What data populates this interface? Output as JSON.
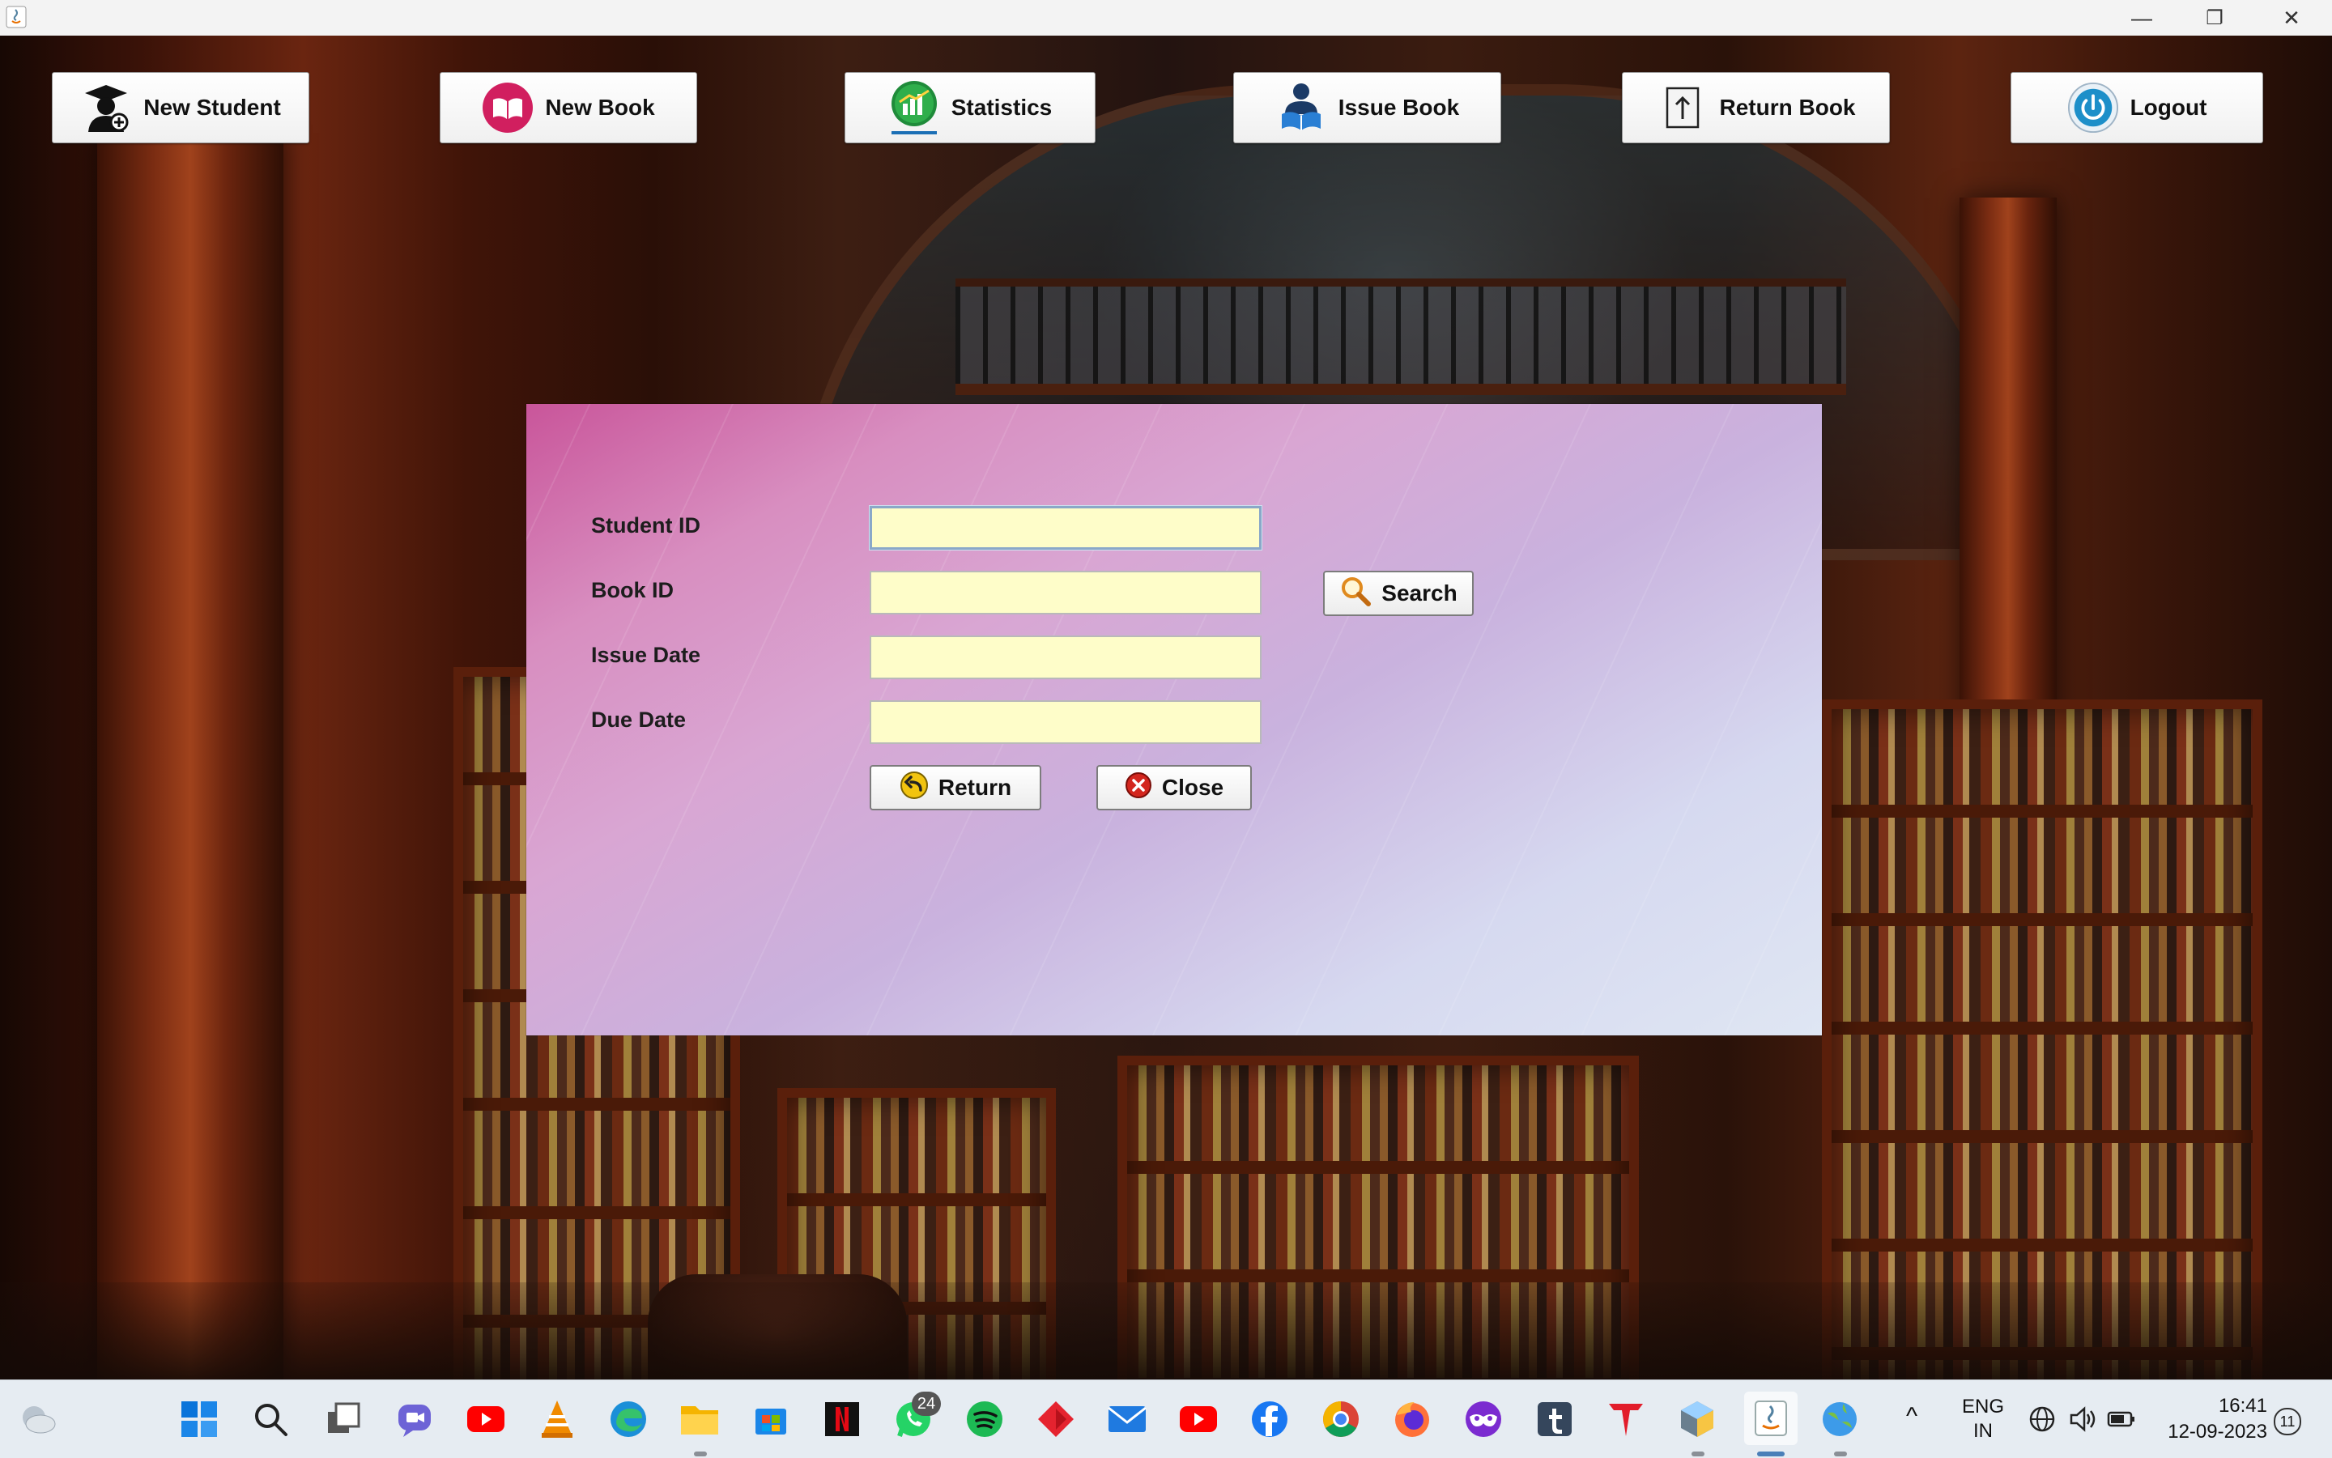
{
  "window": {
    "minimize_glyph": "—",
    "restore_glyph": "❐",
    "close_glyph": "✕"
  },
  "nav": {
    "buttons": [
      {
        "label": "New Student",
        "icon": "student-add-icon"
      },
      {
        "label": "New Book",
        "icon": "book-icon"
      },
      {
        "label": "Statistics",
        "icon": "chart-icon"
      },
      {
        "label": "Issue Book",
        "icon": "reader-icon"
      },
      {
        "label": "Return Book",
        "icon": "return-upload-icon"
      },
      {
        "label": "Logout",
        "icon": "power-icon"
      }
    ]
  },
  "form": {
    "student_id_label": "Student ID",
    "book_id_label": "Book ID",
    "issue_date_label": "Issue Date",
    "due_date_label": "Due Date",
    "student_id_value": "",
    "book_id_value": "",
    "issue_date_value": "",
    "due_date_value": "",
    "search_label": "Search",
    "return_label": "Return",
    "close_label": "Close"
  },
  "taskbar": {
    "whatsapp_badge": "24",
    "language_line1": "ENG",
    "language_line2": "IN",
    "time": "16:41",
    "date": "12-09-2023",
    "notification_count": "11"
  },
  "colors": {
    "field_background": "#fefdc9",
    "panel_pink": "#c9559a",
    "panel_light": "#dfe6f3"
  }
}
